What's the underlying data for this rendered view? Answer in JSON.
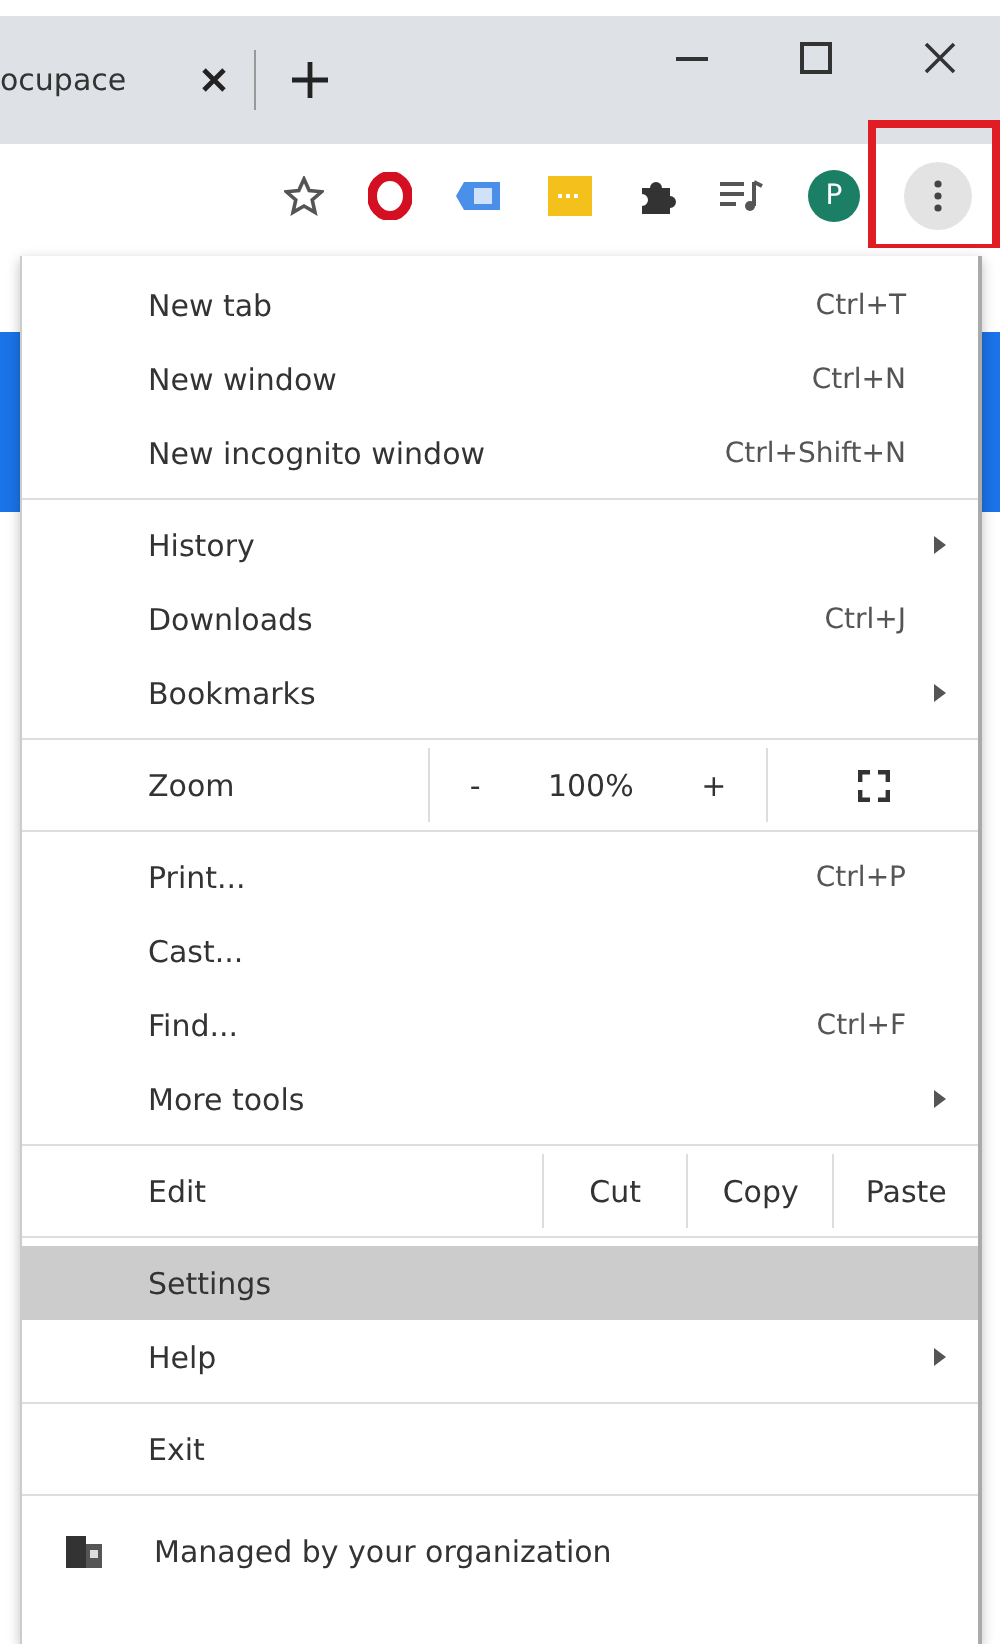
{
  "tab": {
    "title": "ocupace"
  },
  "toolbar": {
    "profile_initial": "P"
  },
  "menu": {
    "sections": [
      {
        "items": [
          {
            "kind": "item",
            "label": "New tab",
            "shortcut": "Ctrl+T",
            "submenu": false,
            "selected": false
          },
          {
            "kind": "item",
            "label": "New window",
            "shortcut": "Ctrl+N",
            "submenu": false,
            "selected": false
          },
          {
            "kind": "item",
            "label": "New incognito window",
            "shortcut": "Ctrl+Shift+N",
            "submenu": false,
            "selected": false
          }
        ]
      },
      {
        "items": [
          {
            "kind": "item",
            "label": "History",
            "submenu": true,
            "selected": false
          },
          {
            "kind": "item",
            "label": "Downloads",
            "shortcut": "Ctrl+J",
            "submenu": false,
            "selected": false
          },
          {
            "kind": "item",
            "label": "Bookmarks",
            "submenu": true,
            "selected": false
          }
        ]
      },
      {
        "items": [
          {
            "kind": "zoom",
            "label": "Zoom",
            "minus": "-",
            "value": "100%",
            "plus": "+",
            "selected": false
          }
        ]
      },
      {
        "items": [
          {
            "kind": "item",
            "label": "Print...",
            "shortcut": "Ctrl+P",
            "submenu": false,
            "selected": false
          },
          {
            "kind": "item",
            "label": "Cast...",
            "submenu": false,
            "selected": false
          },
          {
            "kind": "item",
            "label": "Find...",
            "shortcut": "Ctrl+F",
            "submenu": false,
            "selected": false
          },
          {
            "kind": "item",
            "label": "More tools",
            "submenu": true,
            "selected": false
          }
        ]
      },
      {
        "items": [
          {
            "kind": "edit",
            "label": "Edit",
            "buttons": [
              "Cut",
              "Copy",
              "Paste"
            ],
            "selected": false
          }
        ]
      },
      {
        "items": [
          {
            "kind": "item",
            "label": "Settings",
            "submenu": false,
            "selected": true
          },
          {
            "kind": "item",
            "label": "Help",
            "submenu": true,
            "selected": false
          }
        ]
      },
      {
        "items": [
          {
            "kind": "item",
            "label": "Exit",
            "submenu": false,
            "selected": false
          }
        ]
      }
    ],
    "footer": {
      "label": "Managed by your organization"
    }
  }
}
